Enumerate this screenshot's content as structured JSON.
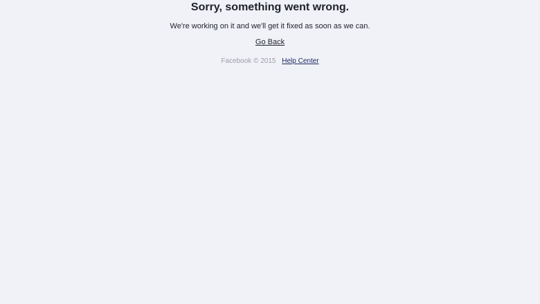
{
  "error": {
    "title": "Sorry, something went wrong.",
    "message": "We're working on it and we'll get it fixed as soon as we can.",
    "go_back_label": "Go Back"
  },
  "footer": {
    "copyright": "Facebook © 2015",
    "help_center_label": "Help Center"
  },
  "colors": {
    "background": "#f1f2f7",
    "text": "#1d2129",
    "muted": "#9a9ea6",
    "link": "#1c2a63"
  }
}
